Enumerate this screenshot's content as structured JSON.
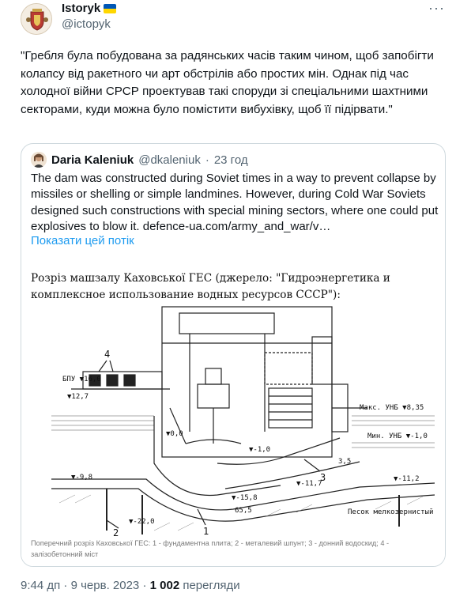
{
  "author": {
    "display_name": "Istoryk",
    "flag": "ukraine-flag",
    "handle": "@ictopyk"
  },
  "more_icon": "more-horizontal-icon",
  "tweet": {
    "text": "\"Гребля була побудована за радянських часів таким чином, щоб запобігти колапсу від ракетного чи арт обстрілів або простих мін. Однак під час холодної війни СРСР проектував такі споруди зі спеціальними шахтними секторами, куди можна було помістити вибухівку, щоб її підірвати.\""
  },
  "quote": {
    "name": "Daria Kaleniuk",
    "handle": "@dkaleniuk",
    "dot": "·",
    "time": "23 год",
    "text": "The dam was constructed during Soviet times in a way to prevent collapse by missiles or shelling or simple landmines. However, during Cold War Soviets designed such constructions with special mining sectors, where one could put explosives to blow it.   defence-ua.com/army_and_war/v…",
    "show_thread": "Показати цей потік",
    "image": {
      "title": "Розріз машзалу Каховської ГЕС (джерело: \"Гидроэнергетика и комплексное использование водных ресурсов СССР\"):",
      "labels": {
        "bpu": "БПУ ▼16,0",
        "l127": "▼12,7",
        "l00": "▼0,0",
        "lm10": "▼-1,0",
        "lm98": "▼-9,8",
        "l35": "3,5",
        "l117": "▼-11,7",
        "l112": "▼-11,2",
        "l158": "▼-15,8",
        "l655": "65,5",
        "l220": "▼-22,0",
        "maks": "Макс. УНБ ▼8,35",
        "min": "Мин. УНБ ▼-1,0",
        "sand": "Песок мелкозернистый",
        "n1": "1",
        "n2": "2",
        "n3": "3",
        "n4": "4"
      },
      "caption": "Поперечний розріз Каховської ГЕС: 1 - фундаментна плита; 2 - металевий шпунт; 3 - донний водоскид; 4 - залізобетонний міст"
    }
  },
  "meta": {
    "time": "9:44 дп",
    "dot1": "·",
    "date": "9 черв. 2023",
    "dot2": "·",
    "views_count": "1 002",
    "views_label": "перегляди"
  }
}
